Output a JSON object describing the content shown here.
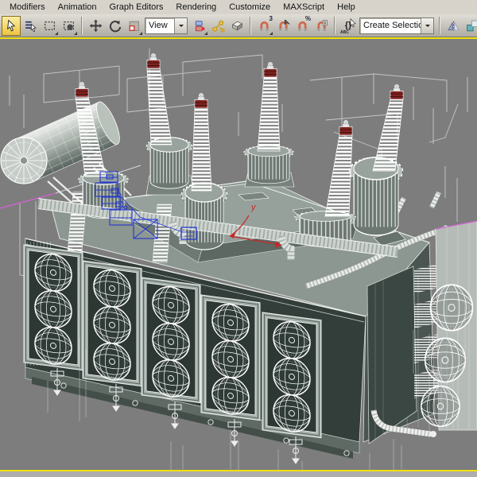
{
  "menubar": {
    "items": [
      "Modifiers",
      "Animation",
      "Graph Editors",
      "Rendering",
      "Customize",
      "MAXScript",
      "Help"
    ]
  },
  "toolbar": {
    "reference_coordinate_system_value": "View",
    "selection_set_value": "Create Selection Set",
    "glyphs": {
      "snap_three": "3",
      "percent": "%",
      "braces": "{}",
      "abc": "ABC"
    },
    "icons": [
      "select-object",
      "select-by-name",
      "rectangular-selection-region",
      "window-crossing-toggle",
      "select-and-move",
      "select-and-rotate",
      "select-and-uniform-scale",
      "reference-coordinate-system",
      "use-pivot-point-center",
      "select-and-manipulate",
      "keyboard-shortcut-override",
      "snap-toggle-3d",
      "angle-snap-toggle",
      "percent-snap-toggle",
      "spinner-snap-toggle",
      "edit-named-selection-sets",
      "named-selection-sets",
      "mirror",
      "align"
    ]
  },
  "viewport": {
    "active_border_color": "#f0e10a",
    "background_color": "#7d7d7d",
    "selection_color": "#2438cf",
    "axis_gizmo": {
      "y_label": "y",
      "color": "#c62828"
    },
    "scene_objects": [
      "power-transformer-tank",
      "conservator-cylinder",
      "hv-bushings",
      "radiator-fan-banks",
      "cooling-pipes",
      "selected-tap-changer",
      "background-wireframe-boxes"
    ]
  }
}
